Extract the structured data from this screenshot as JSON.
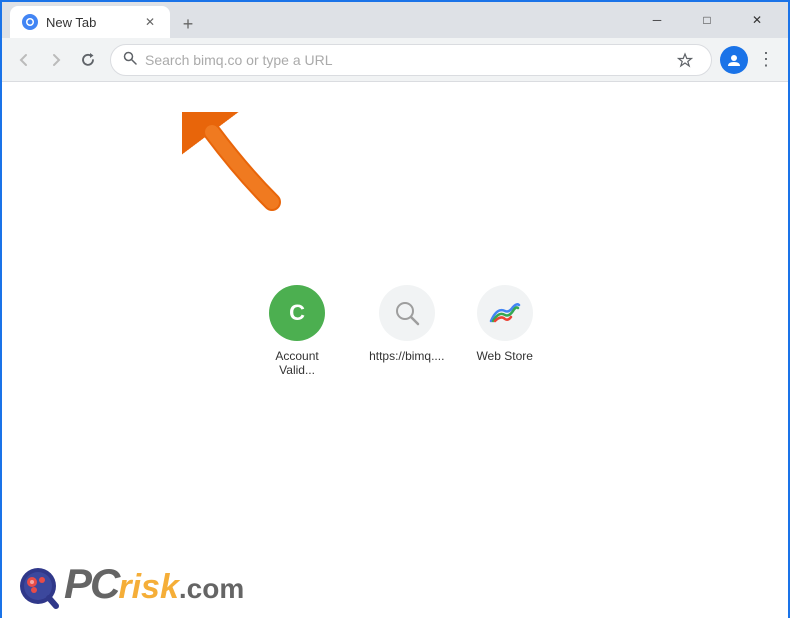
{
  "window": {
    "title": "New Tab",
    "favicon": "●",
    "tab_close": "✕",
    "new_tab": "+"
  },
  "window_controls": {
    "minimize": "─",
    "maximize": "□",
    "close": "✕"
  },
  "toolbar": {
    "back_label": "←",
    "forward_label": "→",
    "refresh_label": "↻",
    "address_placeholder": "Search bimq.co or type a URL",
    "address_value": "Search bimq.co or type a URL",
    "star_icon": "☆",
    "profile_icon": "person",
    "menu_icon": "⋮"
  },
  "shortcuts": [
    {
      "id": "account-valid",
      "label": "Account Valid...",
      "icon_type": "green-c",
      "icon_char": "C"
    },
    {
      "id": "bimq",
      "label": "https://bimq....",
      "icon_type": "search",
      "icon_char": "🔍"
    },
    {
      "id": "web-store",
      "label": "Web Store",
      "icon_type": "rainbow",
      "icon_char": "🌈"
    }
  ],
  "watermark": {
    "pc": "PC",
    "risk": "risk",
    "com": ".com"
  }
}
